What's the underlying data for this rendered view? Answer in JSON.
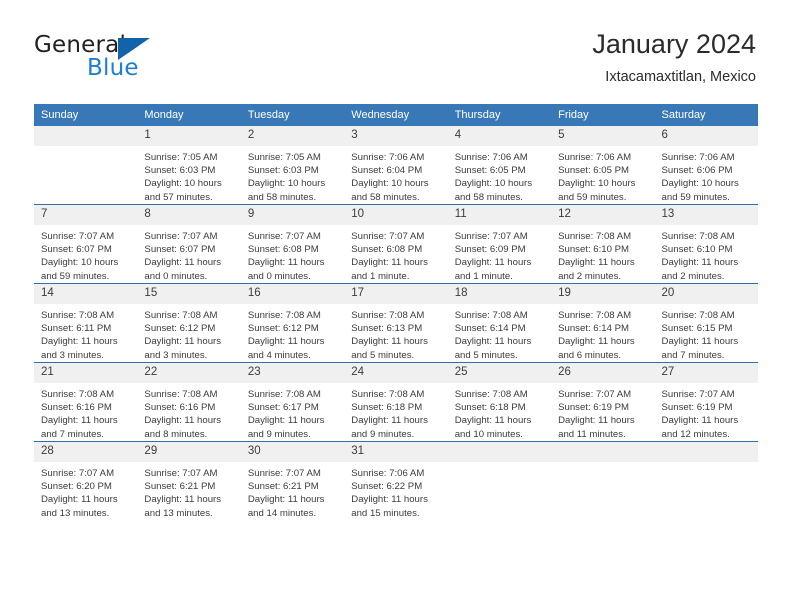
{
  "brand": {
    "name_part1": "General",
    "name_part2": "Blue",
    "triangle_icon": "triangle-icon",
    "accent_color": "#1263a8",
    "blue_text_color": "#1c7fd4"
  },
  "header": {
    "title": "January 2024",
    "subtitle": "Ixtacamaxtitlan, Mexico"
  },
  "calendar": {
    "header_bg": "#3878b6",
    "header_text_color": "#ffffff",
    "daynum_bg": "#f0f0f0",
    "row_rule_color": "#2e6fad",
    "weekday_headers": [
      "Sunday",
      "Monday",
      "Tuesday",
      "Wednesday",
      "Thursday",
      "Friday",
      "Saturday"
    ],
    "weeks": [
      [
        {
          "day": "",
          "sunrise": "",
          "sunset": "",
          "daylight_line1": "",
          "daylight_line2": ""
        },
        {
          "day": "1",
          "sunrise": "Sunrise: 7:05 AM",
          "sunset": "Sunset: 6:03 PM",
          "daylight_line1": "Daylight: 10 hours",
          "daylight_line2": "and 57 minutes."
        },
        {
          "day": "2",
          "sunrise": "Sunrise: 7:05 AM",
          "sunset": "Sunset: 6:03 PM",
          "daylight_line1": "Daylight: 10 hours",
          "daylight_line2": "and 58 minutes."
        },
        {
          "day": "3",
          "sunrise": "Sunrise: 7:06 AM",
          "sunset": "Sunset: 6:04 PM",
          "daylight_line1": "Daylight: 10 hours",
          "daylight_line2": "and 58 minutes."
        },
        {
          "day": "4",
          "sunrise": "Sunrise: 7:06 AM",
          "sunset": "Sunset: 6:05 PM",
          "daylight_line1": "Daylight: 10 hours",
          "daylight_line2": "and 58 minutes."
        },
        {
          "day": "5",
          "sunrise": "Sunrise: 7:06 AM",
          "sunset": "Sunset: 6:05 PM",
          "daylight_line1": "Daylight: 10 hours",
          "daylight_line2": "and 59 minutes."
        },
        {
          "day": "6",
          "sunrise": "Sunrise: 7:06 AM",
          "sunset": "Sunset: 6:06 PM",
          "daylight_line1": "Daylight: 10 hours",
          "daylight_line2": "and 59 minutes."
        }
      ],
      [
        {
          "day": "7",
          "sunrise": "Sunrise: 7:07 AM",
          "sunset": "Sunset: 6:07 PM",
          "daylight_line1": "Daylight: 10 hours",
          "daylight_line2": "and 59 minutes."
        },
        {
          "day": "8",
          "sunrise": "Sunrise: 7:07 AM",
          "sunset": "Sunset: 6:07 PM",
          "daylight_line1": "Daylight: 11 hours",
          "daylight_line2": "and 0 minutes."
        },
        {
          "day": "9",
          "sunrise": "Sunrise: 7:07 AM",
          "sunset": "Sunset: 6:08 PM",
          "daylight_line1": "Daylight: 11 hours",
          "daylight_line2": "and 0 minutes."
        },
        {
          "day": "10",
          "sunrise": "Sunrise: 7:07 AM",
          "sunset": "Sunset: 6:08 PM",
          "daylight_line1": "Daylight: 11 hours",
          "daylight_line2": "and 1 minute."
        },
        {
          "day": "11",
          "sunrise": "Sunrise: 7:07 AM",
          "sunset": "Sunset: 6:09 PM",
          "daylight_line1": "Daylight: 11 hours",
          "daylight_line2": "and 1 minute."
        },
        {
          "day": "12",
          "sunrise": "Sunrise: 7:08 AM",
          "sunset": "Sunset: 6:10 PM",
          "daylight_line1": "Daylight: 11 hours",
          "daylight_line2": "and 2 minutes."
        },
        {
          "day": "13",
          "sunrise": "Sunrise: 7:08 AM",
          "sunset": "Sunset: 6:10 PM",
          "daylight_line1": "Daylight: 11 hours",
          "daylight_line2": "and 2 minutes."
        }
      ],
      [
        {
          "day": "14",
          "sunrise": "Sunrise: 7:08 AM",
          "sunset": "Sunset: 6:11 PM",
          "daylight_line1": "Daylight: 11 hours",
          "daylight_line2": "and 3 minutes."
        },
        {
          "day": "15",
          "sunrise": "Sunrise: 7:08 AM",
          "sunset": "Sunset: 6:12 PM",
          "daylight_line1": "Daylight: 11 hours",
          "daylight_line2": "and 3 minutes."
        },
        {
          "day": "16",
          "sunrise": "Sunrise: 7:08 AM",
          "sunset": "Sunset: 6:12 PM",
          "daylight_line1": "Daylight: 11 hours",
          "daylight_line2": "and 4 minutes."
        },
        {
          "day": "17",
          "sunrise": "Sunrise: 7:08 AM",
          "sunset": "Sunset: 6:13 PM",
          "daylight_line1": "Daylight: 11 hours",
          "daylight_line2": "and 5 minutes."
        },
        {
          "day": "18",
          "sunrise": "Sunrise: 7:08 AM",
          "sunset": "Sunset: 6:14 PM",
          "daylight_line1": "Daylight: 11 hours",
          "daylight_line2": "and 5 minutes."
        },
        {
          "day": "19",
          "sunrise": "Sunrise: 7:08 AM",
          "sunset": "Sunset: 6:14 PM",
          "daylight_line1": "Daylight: 11 hours",
          "daylight_line2": "and 6 minutes."
        },
        {
          "day": "20",
          "sunrise": "Sunrise: 7:08 AM",
          "sunset": "Sunset: 6:15 PM",
          "daylight_line1": "Daylight: 11 hours",
          "daylight_line2": "and 7 minutes."
        }
      ],
      [
        {
          "day": "21",
          "sunrise": "Sunrise: 7:08 AM",
          "sunset": "Sunset: 6:16 PM",
          "daylight_line1": "Daylight: 11 hours",
          "daylight_line2": "and 7 minutes."
        },
        {
          "day": "22",
          "sunrise": "Sunrise: 7:08 AM",
          "sunset": "Sunset: 6:16 PM",
          "daylight_line1": "Daylight: 11 hours",
          "daylight_line2": "and 8 minutes."
        },
        {
          "day": "23",
          "sunrise": "Sunrise: 7:08 AM",
          "sunset": "Sunset: 6:17 PM",
          "daylight_line1": "Daylight: 11 hours",
          "daylight_line2": "and 9 minutes."
        },
        {
          "day": "24",
          "sunrise": "Sunrise: 7:08 AM",
          "sunset": "Sunset: 6:18 PM",
          "daylight_line1": "Daylight: 11 hours",
          "daylight_line2": "and 9 minutes."
        },
        {
          "day": "25",
          "sunrise": "Sunrise: 7:08 AM",
          "sunset": "Sunset: 6:18 PM",
          "daylight_line1": "Daylight: 11 hours",
          "daylight_line2": "and 10 minutes."
        },
        {
          "day": "26",
          "sunrise": "Sunrise: 7:07 AM",
          "sunset": "Sunset: 6:19 PM",
          "daylight_line1": "Daylight: 11 hours",
          "daylight_line2": "and 11 minutes."
        },
        {
          "day": "27",
          "sunrise": "Sunrise: 7:07 AM",
          "sunset": "Sunset: 6:19 PM",
          "daylight_line1": "Daylight: 11 hours",
          "daylight_line2": "and 12 minutes."
        }
      ],
      [
        {
          "day": "28",
          "sunrise": "Sunrise: 7:07 AM",
          "sunset": "Sunset: 6:20 PM",
          "daylight_line1": "Daylight: 11 hours",
          "daylight_line2": "and 13 minutes."
        },
        {
          "day": "29",
          "sunrise": "Sunrise: 7:07 AM",
          "sunset": "Sunset: 6:21 PM",
          "daylight_line1": "Daylight: 11 hours",
          "daylight_line2": "and 13 minutes."
        },
        {
          "day": "30",
          "sunrise": "Sunrise: 7:07 AM",
          "sunset": "Sunset: 6:21 PM",
          "daylight_line1": "Daylight: 11 hours",
          "daylight_line2": "and 14 minutes."
        },
        {
          "day": "31",
          "sunrise": "Sunrise: 7:06 AM",
          "sunset": "Sunset: 6:22 PM",
          "daylight_line1": "Daylight: 11 hours",
          "daylight_line2": "and 15 minutes."
        },
        {
          "day": "",
          "sunrise": "",
          "sunset": "",
          "daylight_line1": "",
          "daylight_line2": ""
        },
        {
          "day": "",
          "sunrise": "",
          "sunset": "",
          "daylight_line1": "",
          "daylight_line2": ""
        },
        {
          "day": "",
          "sunrise": "",
          "sunset": "",
          "daylight_line1": "",
          "daylight_line2": ""
        }
      ]
    ]
  }
}
